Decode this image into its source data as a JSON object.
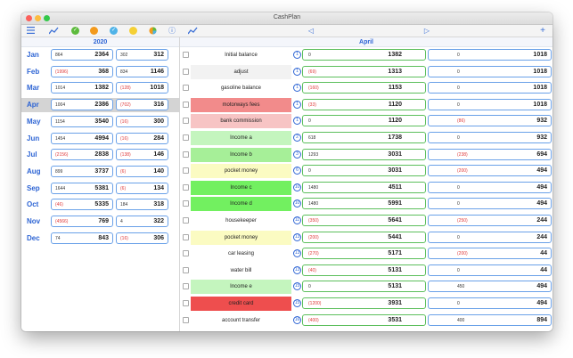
{
  "window": {
    "title": "CashPlan"
  },
  "toolbar": {
    "colors": {
      "accent": "#3b6fd6",
      "green": "#5dbb3d",
      "orange": "#f39a1c",
      "cyan": "#4fb3e8",
      "yellow": "#f5d035"
    }
  },
  "left": {
    "year": "2020",
    "months": [
      {
        "name": "Jan",
        "a_small": "864",
        "a_big": "2364",
        "b_small": "302",
        "b_big": "312",
        "a_neg": false,
        "b_neg": false
      },
      {
        "name": "Feb",
        "a_small": "(1996)",
        "a_big": "368",
        "b_small": "834",
        "b_big": "1146",
        "a_neg": true,
        "b_neg": false
      },
      {
        "name": "Mar",
        "a_small": "1014",
        "a_big": "1382",
        "b_small": "(128)",
        "b_big": "1018",
        "a_neg": false,
        "b_neg": true
      },
      {
        "name": "Apr",
        "a_small": "1004",
        "a_big": "2386",
        "b_small": "(702)",
        "b_big": "316",
        "a_neg": false,
        "b_neg": true,
        "selected": true
      },
      {
        "name": "May",
        "a_small": "1154",
        "a_big": "3540",
        "b_small": "(16)",
        "b_big": "300",
        "a_neg": false,
        "b_neg": true
      },
      {
        "name": "Jun",
        "a_small": "1454",
        "a_big": "4994",
        "b_small": "(16)",
        "b_big": "284",
        "a_neg": false,
        "b_neg": true
      },
      {
        "name": "Jul",
        "a_small": "(2156)",
        "a_big": "2838",
        "b_small": "(138)",
        "b_big": "146",
        "a_neg": true,
        "b_neg": true
      },
      {
        "name": "Aug",
        "a_small": "899",
        "a_big": "3737",
        "b_small": "(6)",
        "b_big": "140",
        "a_neg": false,
        "b_neg": true
      },
      {
        "name": "Sep",
        "a_small": "1644",
        "a_big": "5381",
        "b_small": "(6)",
        "b_big": "134",
        "a_neg": false,
        "b_neg": true
      },
      {
        "name": "Oct",
        "a_small": "(46)",
        "a_big": "5335",
        "b_small": "184",
        "b_big": "318",
        "a_neg": true,
        "b_neg": false
      },
      {
        "name": "Nov",
        "a_small": "(4566)",
        "a_big": "769",
        "b_small": "4",
        "b_big": "322",
        "a_neg": true,
        "b_neg": false
      },
      {
        "name": "Dec",
        "a_small": "74",
        "a_big": "843",
        "b_small": "(16)",
        "b_big": "306",
        "a_neg": false,
        "b_neg": true
      }
    ]
  },
  "right": {
    "month": "April",
    "rows": [
      {
        "name": "Initial balance",
        "day": "1",
        "a_small": "0",
        "a_big": "1382",
        "b_small": "0",
        "b_big": "1018",
        "bg": "#ffffff",
        "a_neg": false,
        "b_neg": false,
        "icon": true
      },
      {
        "name": "adjust",
        "day": "1",
        "a_small": "(69)",
        "a_big": "1313",
        "b_small": "0",
        "b_big": "1018",
        "bg": "#f2f2f2",
        "a_neg": true,
        "b_neg": false
      },
      {
        "name": "gasoline balance",
        "day": "1",
        "a_small": "(160)",
        "a_big": "1153",
        "b_small": "0",
        "b_big": "1018",
        "bg": "#ffffff",
        "a_neg": true,
        "b_neg": false
      },
      {
        "name": "motorways fees",
        "day": "1",
        "a_small": "(33)",
        "a_big": "1120",
        "b_small": "0",
        "b_big": "1018",
        "bg": "#f28b8b",
        "a_neg": true,
        "b_neg": false
      },
      {
        "name": "bank commission",
        "day": "1",
        "a_small": "0",
        "a_big": "1120",
        "b_small": "(86)",
        "b_big": "932",
        "bg": "#f7c4c4",
        "a_neg": false,
        "b_neg": true
      },
      {
        "name": "Income a",
        "day": "2",
        "a_small": "618",
        "a_big": "1738",
        "b_small": "0",
        "b_big": "932",
        "bg": "#c4f5be",
        "a_neg": false,
        "b_neg": false
      },
      {
        "name": "Income b",
        "day": "3",
        "a_small": "1293",
        "a_big": "3031",
        "b_small": "(238)",
        "b_big": "694",
        "bg": "#a6ef98",
        "a_neg": false,
        "b_neg": true
      },
      {
        "name": "pocket money",
        "day": "6",
        "a_small": "0",
        "a_big": "3031",
        "b_small": "(200)",
        "b_big": "494",
        "bg": "#fbfbc2",
        "a_neg": false,
        "b_neg": true
      },
      {
        "name": "Income c",
        "day": "10",
        "a_small": "1480",
        "a_big": "4511",
        "b_small": "0",
        "b_big": "494",
        "bg": "#72f060",
        "a_neg": false,
        "b_neg": false
      },
      {
        "name": "Income d",
        "day": "10",
        "a_small": "1480",
        "a_big": "5991",
        "b_small": "0",
        "b_big": "494",
        "bg": "#72f060",
        "a_neg": false,
        "b_neg": false
      },
      {
        "name": "housekeeper",
        "day": "11",
        "a_small": "(350)",
        "a_big": "5641",
        "b_small": "(250)",
        "b_big": "244",
        "bg": "#ffffff",
        "a_neg": true,
        "b_neg": true
      },
      {
        "name": "pocket money",
        "day": "13",
        "a_small": "(200)",
        "a_big": "5441",
        "b_small": "0",
        "b_big": "244",
        "bg": "#fbfbc2",
        "a_neg": true,
        "b_neg": false
      },
      {
        "name": "car leasing",
        "day": "13",
        "a_small": "(270)",
        "a_big": "5171",
        "b_small": "(200)",
        "b_big": "44",
        "bg": "#ffffff",
        "a_neg": true,
        "b_neg": true
      },
      {
        "name": "water bill",
        "day": "13",
        "a_small": "(40)",
        "a_big": "5131",
        "b_small": "0",
        "b_big": "44",
        "bg": "#ffffff",
        "a_neg": true,
        "b_neg": false
      },
      {
        "name": "Income e",
        "day": "15",
        "a_small": "0",
        "a_big": "5131",
        "b_small": "450",
        "b_big": "494",
        "bg": "#c4f5be",
        "a_neg": false,
        "b_neg": false
      },
      {
        "name": "credit card",
        "day": "15",
        "a_small": "(1200)",
        "a_big": "3931",
        "b_small": "0",
        "b_big": "494",
        "bg": "#ee4e4e",
        "a_neg": true,
        "b_neg": false
      },
      {
        "name": "account transfer",
        "day": "16",
        "a_small": "(400)",
        "a_big": "3531",
        "b_small": "400",
        "b_big": "894",
        "bg": "#ffffff",
        "a_neg": true,
        "b_neg": false
      }
    ]
  }
}
